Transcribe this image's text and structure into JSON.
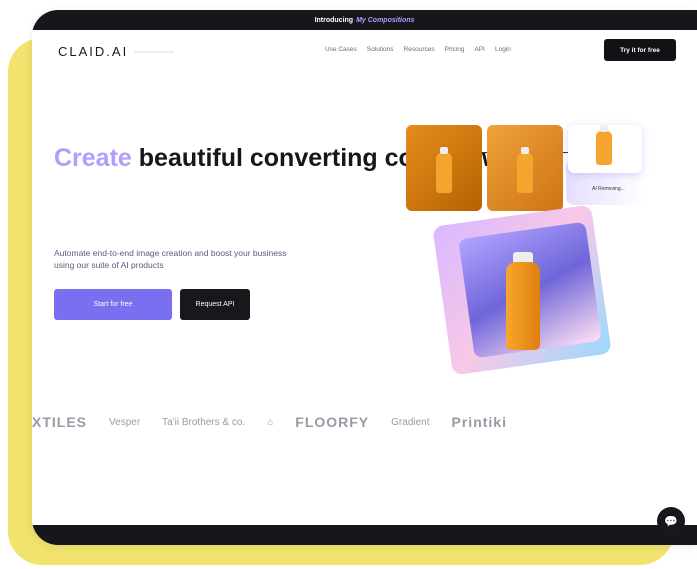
{
  "topbar": {
    "prefix": "Introducing",
    "highlight": "My Compositions"
  },
  "nav": {
    "logo": "CLAID.AI",
    "links": [
      "Use Cases",
      "Solutions",
      "Resources",
      "Pricing",
      "API",
      "Login"
    ],
    "cta": "Try it for free"
  },
  "hero": {
    "headline_accent": "Create",
    "headline_rest": " beautiful converting content with AI",
    "subtitle": "Automate end-to-end image creation and boost your business using our suite of AI products",
    "primary_button": "Start for free",
    "secondary_button": "Request API",
    "removing_label": "AI Removing..."
  },
  "logos": [
    "XTILES",
    "Vesper",
    "Ta'ii Brothers & co.",
    "FLOORFY",
    "Gradient",
    "Printiki"
  ]
}
